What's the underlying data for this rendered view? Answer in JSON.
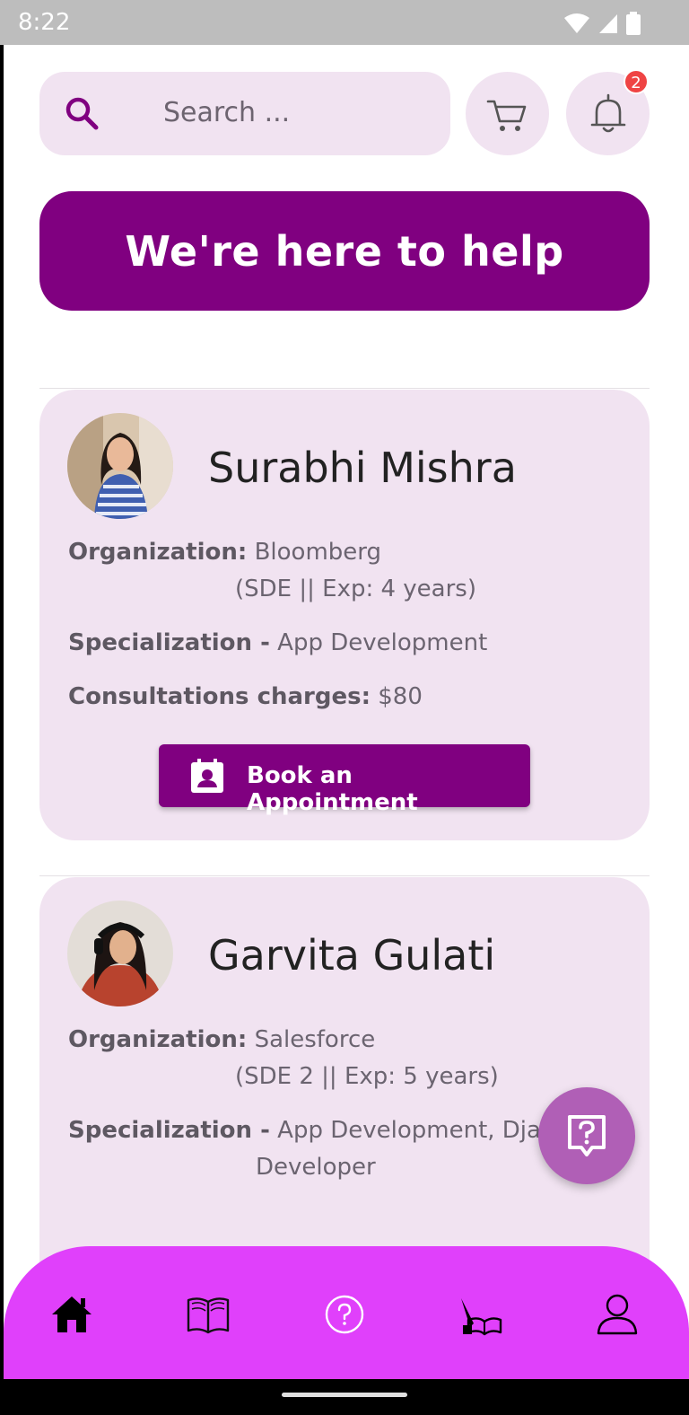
{
  "status_bar": {
    "time": "8:22"
  },
  "search": {
    "placeholder": "Search ..."
  },
  "header": {
    "notification_count": "2"
  },
  "banner": {
    "text": "We're here to help"
  },
  "mentors": [
    {
      "name": "Surabhi Mishra",
      "organization_label": "Organization:",
      "organization": "Bloomberg",
      "role": "(SDE || Exp: 4 years)",
      "specialization_label": "Specialization -",
      "specialization": "App Development",
      "charges_label": "Consultations charges:",
      "charges": "$80",
      "book_label": "Book an Appointment"
    },
    {
      "name": "Garvita Gulati",
      "organization_label": "Organization:",
      "organization": "Salesforce",
      "role": "(SDE 2 || Exp: 5 years)",
      "specialization_label": "Specialization -",
      "specialization_line1": "App Development, Django",
      "specialization_line2": "Developer"
    }
  ],
  "bottom_nav": {
    "items": [
      "home-icon",
      "book-open-icon",
      "help-circle-icon",
      "writing-book-icon",
      "profile-icon"
    ]
  },
  "colors": {
    "primary": "#800080",
    "card_bg": "#f1e3f1",
    "nav_bg": "#e040fb",
    "fab_bg": "#b05fb6",
    "badge": "#ef4444"
  }
}
